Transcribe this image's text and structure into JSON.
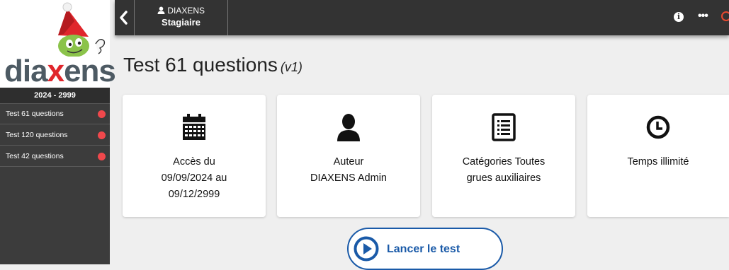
{
  "brand": {
    "logo_text_a": "dia",
    "logo_text_x": "x",
    "logo_text_b": "ens"
  },
  "sidebar": {
    "period": "2024 - 2999",
    "items": [
      {
        "label": "Test 61 questions",
        "status_color": "#f0484c"
      },
      {
        "label": "Test 120 questions",
        "status_color": "#f0484c"
      },
      {
        "label": "Test 42 questions",
        "status_color": "#f0484c"
      }
    ]
  },
  "topbar": {
    "back_icon": "chevron-left-icon",
    "user_name": "DIAXENS",
    "user_role": "Stagiaire",
    "info_icon": "info-icon",
    "info_glyph": "i",
    "more_icon": "more-icon",
    "more_glyph": "•••",
    "power_icon": "power-icon"
  },
  "main": {
    "title": "Test 61 questions",
    "version": "(v1)",
    "cards": [
      {
        "icon": "calendar-icon",
        "lines": [
          "Accès du",
          "09/09/2024 au",
          "09/12/2999"
        ]
      },
      {
        "icon": "user-icon",
        "lines": [
          "Auteur",
          "DIAXENS Admin"
        ]
      },
      {
        "icon": "list-icon",
        "lines": [
          "Catégories Toutes",
          "grues auxiliaires"
        ]
      },
      {
        "icon": "clock-icon",
        "lines": [
          "Temps illimité"
        ]
      }
    ],
    "launch_button": "Lancer le test"
  },
  "colors": {
    "accent": "#1a5aa8",
    "status_red": "#f0484c",
    "topbar": "#333333",
    "sidebar": "#3c3c3c"
  }
}
